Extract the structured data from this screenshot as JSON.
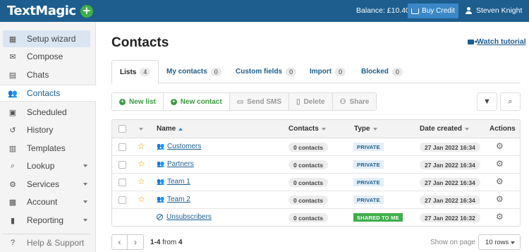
{
  "header": {
    "logo": "TextMagic",
    "balance": "Balance: £10.40",
    "buy_credit": "Buy Credit",
    "user_name": "Steven Knight"
  },
  "sidebar": {
    "items": [
      {
        "label": "Setup wizard",
        "icon": "dashboard-icon"
      },
      {
        "label": "Compose",
        "icon": "compose-icon"
      },
      {
        "label": "Chats",
        "icon": "chat-icon"
      },
      {
        "label": "Contacts",
        "icon": "contacts-icon"
      },
      {
        "label": "Scheduled",
        "icon": "calendar-icon"
      },
      {
        "label": "History",
        "icon": "history-icon"
      },
      {
        "label": "Templates",
        "icon": "clipboard-icon"
      },
      {
        "label": "Lookup",
        "icon": "search-icon"
      },
      {
        "label": "Services",
        "icon": "services-icon"
      },
      {
        "label": "Account",
        "icon": "account-icon"
      },
      {
        "label": "Reporting",
        "icon": "chart-icon"
      },
      {
        "label": "Help & Support",
        "icon": "help-icon"
      }
    ]
  },
  "main": {
    "title": "Contacts",
    "watch_tutorial": "Watch tutorial",
    "tabs": [
      {
        "label": "Lists",
        "count": "4"
      },
      {
        "label": "My contacts",
        "count": "0"
      },
      {
        "label": "Custom fields",
        "count": "0"
      },
      {
        "label": "Import",
        "count": "0"
      },
      {
        "label": "Blocked",
        "count": "0"
      }
    ],
    "toolbar": {
      "new_list": "New list",
      "new_contact": "New contact",
      "send_sms": "Send SMS",
      "delete": "Delete",
      "share": "Share"
    },
    "table": {
      "columns": {
        "name": "Name",
        "contacts": "Contacts",
        "type": "Type",
        "date_created": "Date created",
        "actions": "Actions"
      },
      "rows": [
        {
          "name": "Customers",
          "contacts": "0 contacts",
          "type": "PRIVATE",
          "date": "27 Jan 2022 16:34"
        },
        {
          "name": "Partners",
          "contacts": "0 contacts",
          "type": "PRIVATE",
          "date": "27 Jan 2022 16:34"
        },
        {
          "name": "Team 1",
          "contacts": "0 contacts",
          "type": "PRIVATE",
          "date": "27 Jan 2022 16:34"
        },
        {
          "name": "Team 2",
          "contacts": "0 contacts",
          "type": "PRIVATE",
          "date": "27 Jan 2022 16:34"
        },
        {
          "name": "Unsubscribers",
          "contacts": "0 contacts",
          "type": "SHARED TO ME",
          "date": "27 Jan 2022 16:32"
        }
      ]
    },
    "footer": {
      "range": "1-4",
      "range_from": "from",
      "range_total": "4",
      "show_on_page": "Show on page",
      "rows_value": "10 rows"
    }
  },
  "colors": {
    "brand": "#1d5e8f",
    "accent_green": "#3fae49",
    "star": "#e0a800"
  }
}
